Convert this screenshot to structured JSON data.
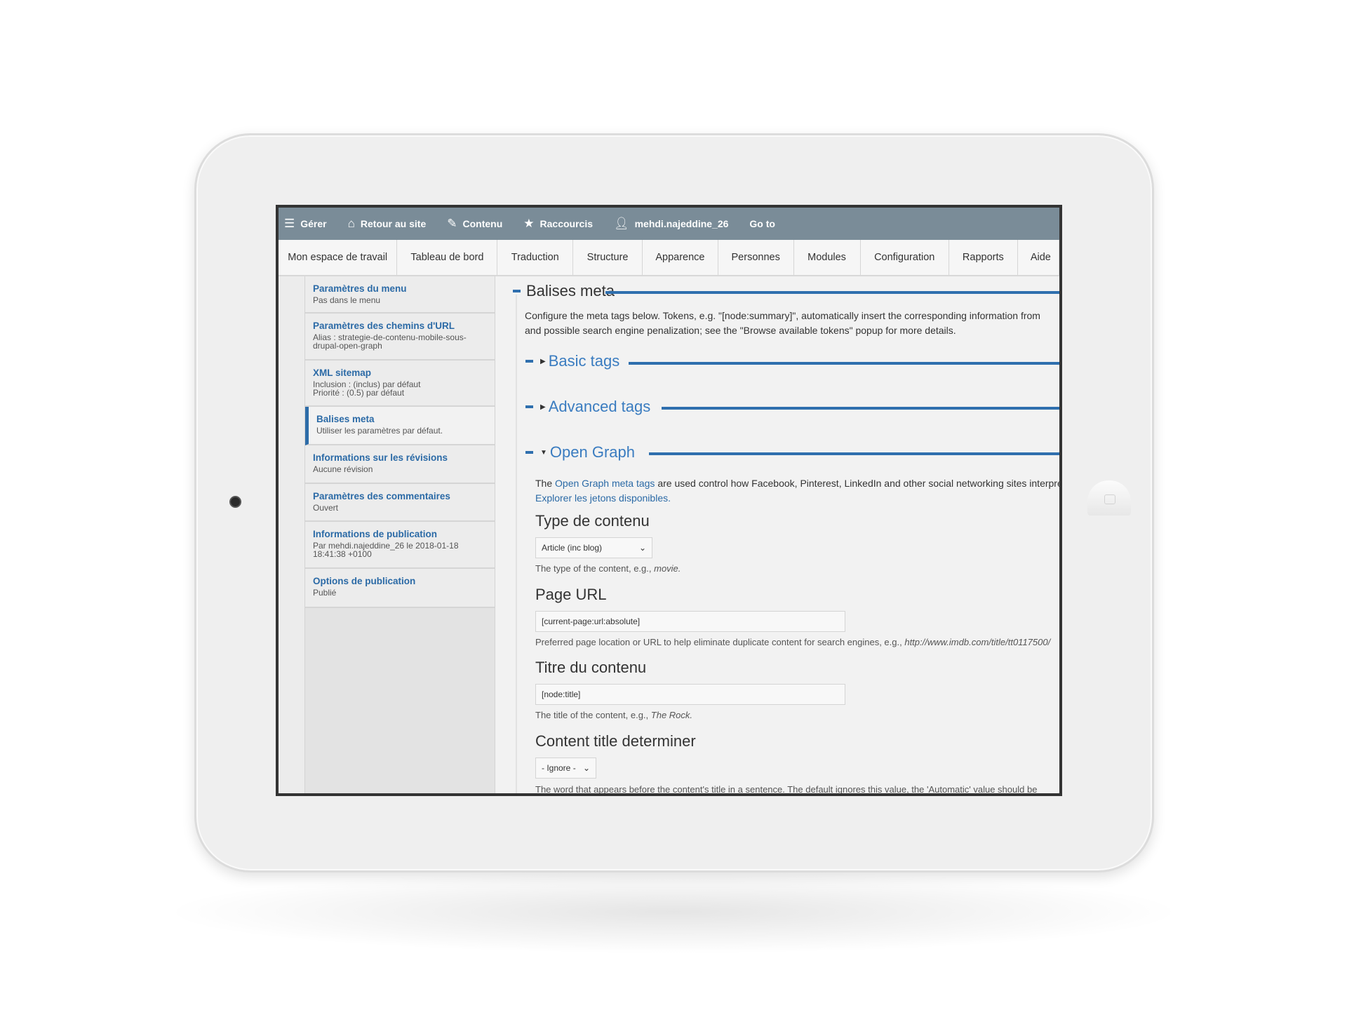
{
  "toolbar": {
    "items": [
      {
        "label": "Gérer",
        "icon": "hamburger-icon"
      },
      {
        "label": "Retour au site",
        "icon": "home-icon"
      },
      {
        "label": "Contenu",
        "icon": "edit-icon"
      },
      {
        "label": "Raccourcis",
        "icon": "star-icon"
      },
      {
        "label": "mehdi.najeddine_26",
        "icon": "user-icon"
      },
      {
        "label": "Go to"
      }
    ]
  },
  "tabs": [
    "Mon espace de travail",
    "Tableau de bord",
    "Traduction",
    "Structure",
    "Apparence",
    "Personnes",
    "Modules",
    "Configuration",
    "Rapports",
    "Aide"
  ],
  "sidebar": {
    "items": [
      {
        "title": "Paramètres du menu",
        "sub": "Pas dans le menu"
      },
      {
        "title": "Paramètres des chemins d'URL",
        "sub": "Alias : strategie-de-contenu-mobile-sous-drupal-open-graph"
      },
      {
        "title": "XML sitemap",
        "sub": "Inclusion : (inclus) par défaut",
        "sub2": "Priorité : (0.5) par défaut"
      },
      {
        "title": "Balises meta",
        "sub": "Utiliser les paramètres par défaut.",
        "active": true
      },
      {
        "title": "Informations sur les révisions",
        "sub": "Aucune révision"
      },
      {
        "title": "Paramètres des commentaires",
        "sub": "Ouvert"
      },
      {
        "title": "Informations de publication",
        "sub": "Par mehdi.najeddine_26 le 2018-01-18 18:41:38 +0100"
      },
      {
        "title": "Options de publication",
        "sub": "Publié"
      }
    ]
  },
  "main": {
    "title": "Balises meta",
    "desc1": "Configure the meta tags below. Tokens, e.g. \"[node:summary]\", automatically insert the corresponding information from",
    "desc2": "and possible search engine penalization; see the \"Browse available tokens\" popup for more details.",
    "basic": "Basic tags",
    "advanced": "Advanced tags",
    "og": {
      "title": "Open Graph",
      "intro_pre": "The ",
      "intro_link": "Open Graph meta tags",
      "intro_post": " are used control how Facebook, Pinterest, LinkedIn and other social networking sites interpret",
      "tokens_link": "Explorer les jetons disponibles.",
      "type_label": "Type de contenu",
      "type_value": "Article (inc blog)",
      "type_help": "The type of the content, e.g., ",
      "type_help_em": "movie.",
      "url_label": "Page URL",
      "url_value": "[current-page:url:absolute]",
      "url_help": "Preferred page location or URL to help eliminate duplicate content for search engines, e.g., ",
      "url_help_em": "http://www.imdb.com/title/tt0117500/",
      "title_label": "Titre du contenu",
      "title_value": "[node:title]",
      "title_help": "The title of the content, e.g., ",
      "title_help_em": "The Rock.",
      "det_label": "Content title determiner",
      "det_value": "- Ignore -",
      "det_help": "The word that appears before the content's title in a sentence. The default ignores this value, the 'Automatic' value should be"
    }
  },
  "colors": {
    "toolbar": "#7a8c98",
    "accent": "#2f6fae",
    "link": "#2b6aa6"
  }
}
